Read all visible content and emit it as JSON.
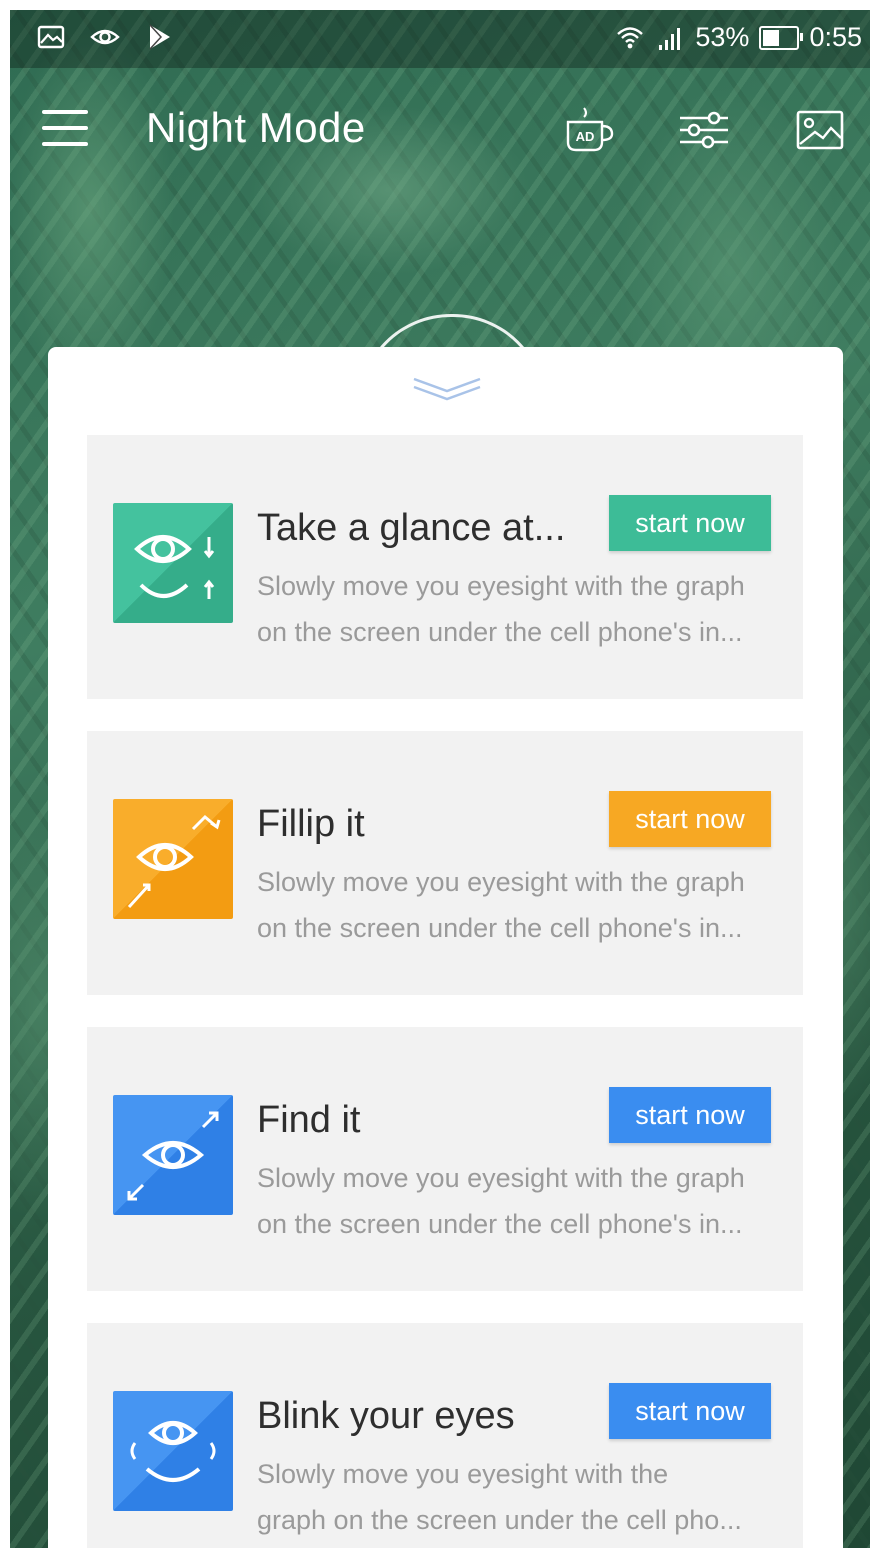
{
  "status_bar": {
    "battery": "53%",
    "time": "0:55",
    "battery_level": 0.53,
    "icons": [
      "gallery-icon",
      "eye-icon",
      "play-store-icon",
      "wifi-icon",
      "signal-icon",
      "battery-icon"
    ]
  },
  "toolbar": {
    "title": "Night Mode",
    "icons": [
      "menu-icon",
      "ad-coffee-icon",
      "sliders-icon",
      "image-icon"
    ]
  },
  "colors": {
    "teal": "#3dbc97",
    "orange": "#f7a823",
    "blue": "#3a8df0",
    "card_bg": "#f2f2f2"
  },
  "exercises": [
    {
      "title": "Take a glance at...",
      "desc_line1": "Slowly move you eyesight with the graph",
      "desc_line2": "on the screen under the cell phone's in...",
      "button": "start now",
      "icon": "eye-updown-icon"
    },
    {
      "title": "Fillip it",
      "desc_line1": "Slowly move you eyesight with the graph",
      "desc_line2": "on the screen under the cell phone's in...",
      "button": "start now",
      "icon": "eye-zigzag-icon"
    },
    {
      "title": "Find it",
      "desc_line1": "Slowly move you eyesight with the graph",
      "desc_line2": "on the screen under the cell phone's in...",
      "button": "start now",
      "icon": "eye-diagonal-icon"
    },
    {
      "title": "Blink your eyes",
      "desc_line1": "Slowly move you eyesight with the",
      "desc_line2": "graph on the screen under the cell pho...",
      "button": "start now",
      "icon": "eye-blink-icon"
    }
  ]
}
